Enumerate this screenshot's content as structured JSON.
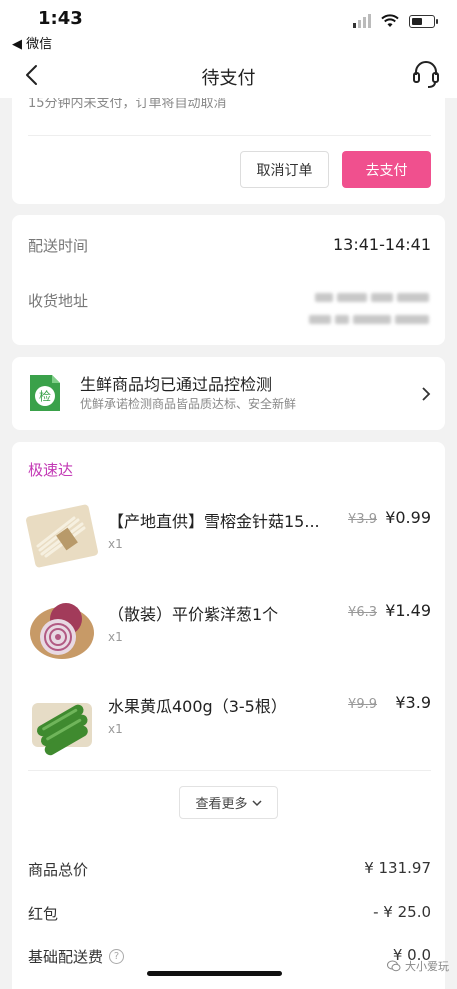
{
  "status_bar": {
    "time": "1:43",
    "back_app": "◀ 微信",
    "battery_level": 0.55
  },
  "nav": {
    "title": "待支付"
  },
  "order_actions": {
    "notice": "15分钟内未支付，订单将自动取消",
    "cancel_label": "取消订单",
    "pay_label": "去支付"
  },
  "delivery": {
    "time_label": "配送时间",
    "time_value": "13:41-14:41",
    "address_label": "收货地址"
  },
  "quality": {
    "title": "生鲜商品均已通过品控检测",
    "subtitle": "优鲜承诺检测商品皆品质达标、安全新鲜",
    "icon_text": "检"
  },
  "items_section": {
    "tag": "极速达",
    "items": [
      {
        "name": "【产地直供】雪榕金针菇15...",
        "qty": "x1",
        "old_price": "¥3.9",
        "price": "¥0.99"
      },
      {
        "name": "（散装）平价紫洋葱1个",
        "qty": "x1",
        "old_price": "¥6.3",
        "price": "¥1.49"
      },
      {
        "name": "水果黄瓜400g（3-5根）",
        "qty": "x1",
        "old_price": "¥9.9",
        "price": "¥3.9"
      }
    ],
    "more_label": "查看更多"
  },
  "summary": [
    {
      "label": "商品总价",
      "value": "¥ 131.97"
    },
    {
      "label": "红包",
      "value": "- ¥ 25.0"
    },
    {
      "label": "基础配送费",
      "value": "¥ 0.0"
    }
  ],
  "watermark": "大小爱玩",
  "colors": {
    "accent_pink": "#f0508e",
    "express_purple": "#c33ab5",
    "quality_green": "#3aa14a"
  }
}
